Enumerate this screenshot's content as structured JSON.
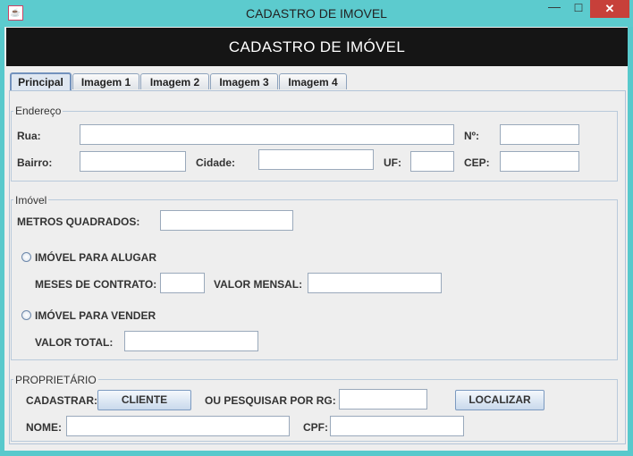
{
  "window": {
    "title": "CADASTRO DE IMOVEL",
    "icon": "java-icon",
    "controls": {
      "minimize": "—",
      "maximize": "☐",
      "close": "✕"
    }
  },
  "header": {
    "title": "CADASTRO DE IMÓVEL"
  },
  "tabs": [
    {
      "label": "Principal",
      "active": true
    },
    {
      "label": "Imagem 1"
    },
    {
      "label": "Imagem 2"
    },
    {
      "label": "Imagem 3"
    },
    {
      "label": "Imagem 4"
    }
  ],
  "endereco": {
    "title": "Endereço",
    "rua_label": "Rua:",
    "rua_value": "",
    "numero_label": "Nº:",
    "numero_value": "",
    "bairro_label": "Bairro:",
    "bairro_value": "",
    "cidade_label": "Cidade:",
    "cidade_value": "",
    "uf_label": "UF:",
    "uf_value": "",
    "cep_label": "CEP:",
    "cep_value": ""
  },
  "imovel": {
    "title": "Imóvel",
    "metros_label": "METROS QUADRADOS:",
    "metros_value": "",
    "alugar_label": "IMÓVEL PARA ALUGAR",
    "meses_label": "MESES DE CONTRATO:",
    "meses_value": "",
    "valor_mensal_label": "VALOR MENSAL:",
    "valor_mensal_value": "",
    "vender_label": "IMÓVEL PARA VENDER",
    "valor_total_label": "VALOR TOTAL:",
    "valor_total_value": ""
  },
  "proprietario": {
    "title": "PROPRIETÁRIO",
    "cadastrar_label": "CADASTRAR:",
    "cliente_button": "CLIENTE",
    "pesquisar_label": "OU PESQUISAR POR RG:",
    "rg_value": "",
    "localizar_button": "LOCALIZAR",
    "nome_label": "NOME:",
    "nome_value": "",
    "cpf_label": "CPF:",
    "cpf_value": ""
  }
}
